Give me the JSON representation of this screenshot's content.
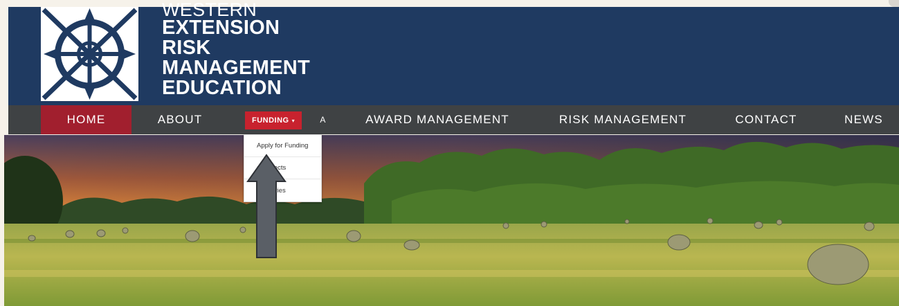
{
  "brand": {
    "lines": [
      "WESTERN",
      "EXTENSION",
      "RISK",
      "MANAGEMENT",
      "EDUCATION"
    ],
    "logo_icon": "compass-wheel-icon"
  },
  "nav": {
    "items": [
      "HOME",
      "ABOUT",
      "FUNDING",
      "A",
      "AWARD MANAGEMENT",
      "RISK MANAGEMENT",
      "CONTACT",
      "NEWS"
    ],
    "active": "HOME",
    "open": "FUNDING",
    "caret": "▾"
  },
  "dropdown": {
    "items": [
      "Apply for Funding",
      "d Projects",
      "ss Stories"
    ]
  },
  "annotation": {
    "arrow_icon": "up-arrow-icon",
    "arrow_color": "#5a5f66"
  },
  "colors": {
    "header_bg": "#1f3a61",
    "nav_bg": "#3f4244",
    "home_active": "#a11f2e",
    "funding_active": "#c8222e"
  }
}
